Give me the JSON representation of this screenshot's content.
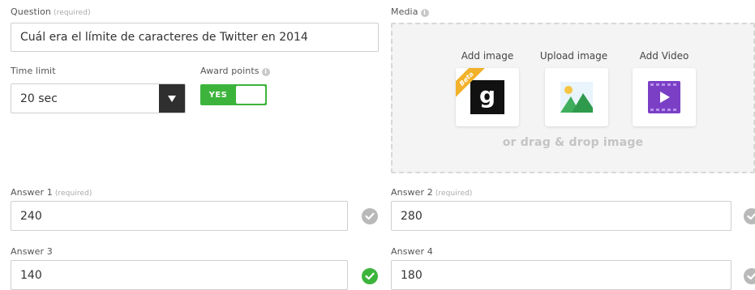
{
  "question": {
    "label": "Question",
    "required_note": "(required)",
    "value": "Cuál era el límite de caracteres de Twitter en 2014"
  },
  "time_limit": {
    "label": "Time limit",
    "value": "20 sec"
  },
  "award_points": {
    "label": "Award points",
    "toggle_text": "YES",
    "enabled": true
  },
  "media": {
    "label": "Media",
    "options": [
      {
        "label": "Add image",
        "icon": "getty-g-icon",
        "badge": "Beta"
      },
      {
        "label": "Upload image",
        "icon": "landscape-image-icon"
      },
      {
        "label": "Add Video",
        "icon": "video-play-icon"
      }
    ],
    "drop_hint": "or drag & drop image"
  },
  "answers": [
    {
      "label": "Answer 1",
      "required_note": "(required)",
      "value": "240",
      "correct": false
    },
    {
      "label": "Answer 2",
      "required_note": "(required)",
      "value": "280",
      "correct": false
    },
    {
      "label": "Answer 3",
      "required_note": "",
      "value": "140",
      "correct": true
    },
    {
      "label": "Answer 4",
      "required_note": "",
      "value": "180",
      "correct": false
    }
  ],
  "colors": {
    "accent_green": "#3cb43c",
    "check_grey": "#b9b9b9",
    "video_purple": "#7b3fc6",
    "select_dark": "#2f2f2f"
  }
}
